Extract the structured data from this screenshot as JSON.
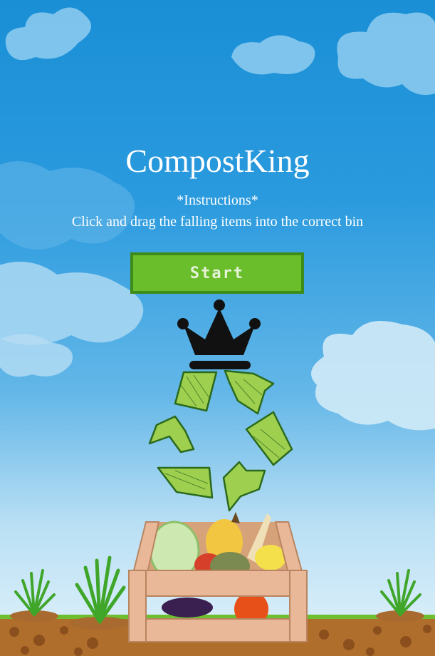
{
  "game": {
    "title": "CompostKing",
    "instructions_heading": "*Instructions*",
    "instructions_text": "Click and drag the falling items into the correct bin",
    "start_label": "Start"
  },
  "colors": {
    "sky_top": "#1a8fd6",
    "sky_bottom": "#e3f3fb",
    "start_button": "#6abe2c",
    "start_button_border": "#3d8b18",
    "crown": "#111111",
    "recycle_arrows": "#9fcf4f",
    "soil": "#b06e2c",
    "grass": "#6dbf2f"
  },
  "icons": [
    "crown-icon",
    "recycle-icon",
    "produce-crate",
    "onion-sprout-icon"
  ]
}
